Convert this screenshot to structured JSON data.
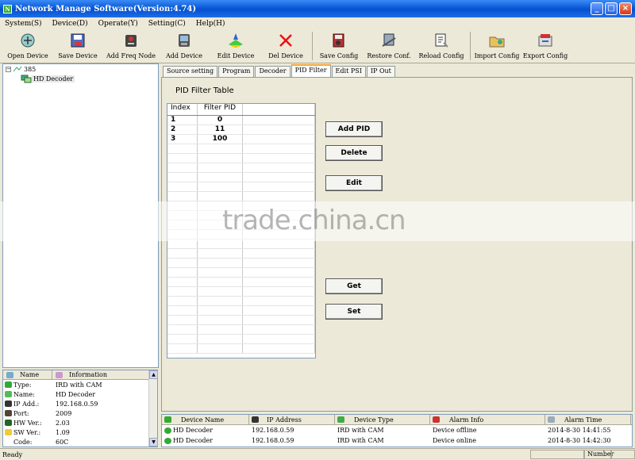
{
  "window": {
    "title": "Network Manage Software(Version:4.74)"
  },
  "menu": [
    "System(S)",
    "Device(D)",
    "Operate(Y)",
    "Setting(C)",
    "Help(H)"
  ],
  "toolbar": [
    {
      "label": "Open Device",
      "icon": "open-device-icon"
    },
    {
      "label": "Save Device",
      "icon": "save-device-icon"
    },
    {
      "label": "Add Freq Node",
      "icon": "add-freq-node-icon"
    },
    {
      "label": "Add Device",
      "icon": "add-device-icon"
    },
    {
      "label": "Edit Device",
      "icon": "edit-device-icon"
    },
    {
      "label": "Del Device",
      "icon": "delete-device-icon"
    },
    {
      "label": "Save Config",
      "icon": "save-config-icon"
    },
    {
      "label": "Restore Conf.",
      "icon": "restore-config-icon"
    },
    {
      "label": "Reload Config",
      "icon": "reload-config-icon"
    },
    {
      "label": "Import Config",
      "icon": "import-config-icon"
    },
    {
      "label": "Export Config",
      "icon": "export-config-icon"
    }
  ],
  "tree": {
    "root": "385",
    "child": "HD Decoder"
  },
  "info": {
    "headers": [
      "Name",
      "Information"
    ],
    "rows": [
      {
        "key": "Type:",
        "value": "IRD with CAM"
      },
      {
        "key": "Name:",
        "value": "HD Decoder"
      },
      {
        "key": "IP Add.:",
        "value": "192.168.0.59"
      },
      {
        "key": "Port:",
        "value": "2009"
      },
      {
        "key": "HW Ver.:",
        "value": "2.03"
      },
      {
        "key": "SW Ver.:",
        "value": "1.09"
      },
      {
        "key": "Code:",
        "value": "60C"
      }
    ]
  },
  "tabs": [
    "Source setting",
    "Program",
    "Decoder",
    "PID Filter",
    "Edit PSI",
    "IP Out"
  ],
  "active_tab": "PID Filter",
  "pid": {
    "title": "PID Filter Table",
    "headers": [
      "Index",
      "Filter PID",
      ""
    ],
    "rows": [
      {
        "index": "1",
        "pid": "0"
      },
      {
        "index": "2",
        "pid": "11"
      },
      {
        "index": "3",
        "pid": "100"
      }
    ],
    "buttons": {
      "add": "Add PID",
      "delete": "Delete",
      "edit": "Edit",
      "get": "Get",
      "set": "Set"
    }
  },
  "watermark": "trade.china.cn",
  "log": {
    "headers": [
      "Device Name",
      "IP Address",
      "Device Type",
      "Alarm Info",
      "Alarm Time"
    ],
    "rows": [
      {
        "name": "HD Decoder",
        "ip": "192.168.0.59",
        "type": "IRD with CAM",
        "info": "Device offline",
        "time": "2014-8-30 14:41:55"
      },
      {
        "name": "HD Decoder",
        "ip": "192.168.0.59",
        "type": "IRD with CAM",
        "info": "Device online",
        "time": "2014-8-30 14:42:30"
      }
    ]
  },
  "status": {
    "text": "Ready",
    "pane": "Number"
  }
}
